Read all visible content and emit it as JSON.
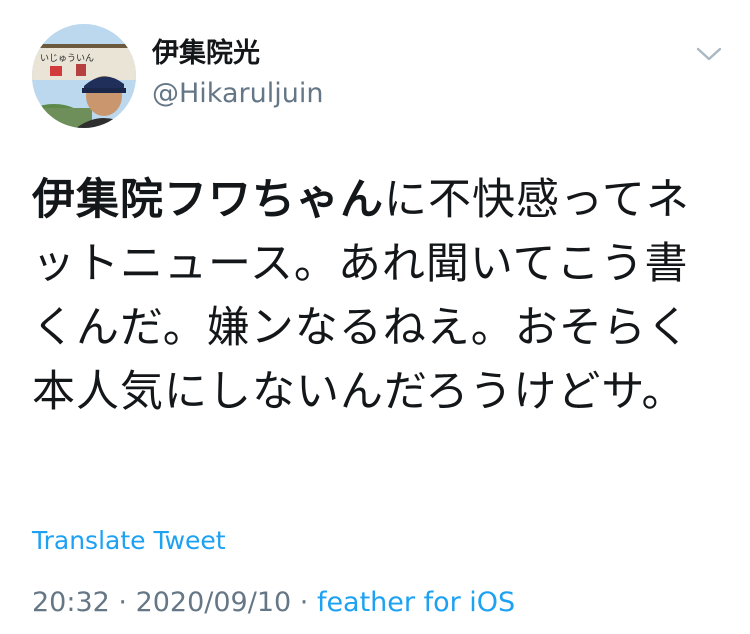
{
  "author": {
    "display_name": "伊集院光",
    "handle": "@Hikaruljuin"
  },
  "avatar": {
    "sign_text": "いじゅういん",
    "icon": "profile-photo"
  },
  "tweet": {
    "text_bold": "伊集院フワちゃん",
    "text_rest": "に不快感ってネットニュース。あれ聞いてこう書くんだ。嫌ンなるねえ。おそらく本人気にしないんだろうけどサ。"
  },
  "translate_label": "Translate Tweet",
  "meta": {
    "time": "20:32",
    "separator1": " · ",
    "date": "2020/09/10",
    "separator2": " · ",
    "source": "feather for iOS"
  },
  "colors": {
    "link": "#1da1f2",
    "secondary": "#657786",
    "text": "#14171a"
  }
}
